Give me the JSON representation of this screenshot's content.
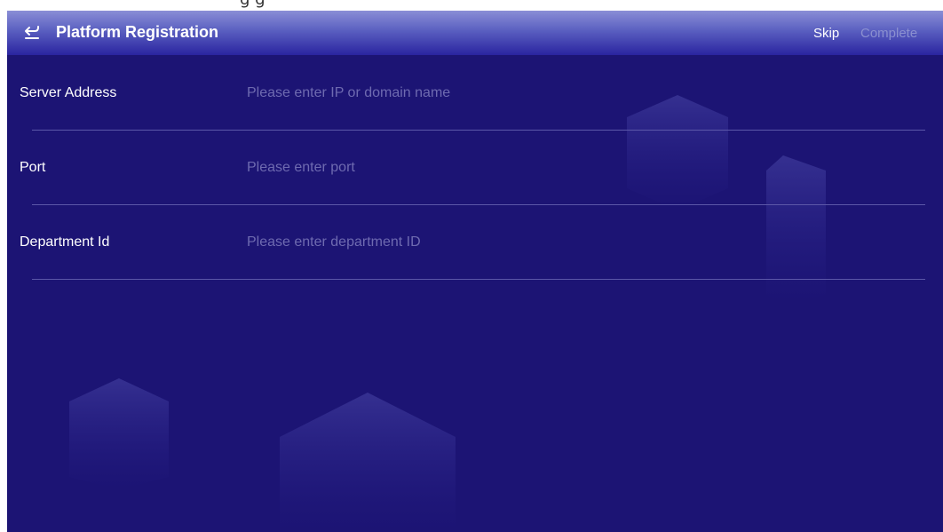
{
  "header": {
    "title": "Platform Registration",
    "skip_label": "Skip",
    "complete_label": "Complete"
  },
  "form": {
    "fields": [
      {
        "label": "Server Address",
        "placeholder": "Please enter IP or domain name",
        "value": ""
      },
      {
        "label": "Port",
        "placeholder": "Please enter port",
        "value": ""
      },
      {
        "label": "Department Id",
        "placeholder": "Please enter department ID",
        "value": ""
      }
    ]
  },
  "colors": {
    "background": "#1c1474",
    "header_top": "#8a8ed6",
    "header_bottom": "#2a24a0",
    "label_text": "#ffffff",
    "placeholder_text": "#6e6ab0",
    "disabled_action": "#8b90d0",
    "divider": "#5b57a8"
  },
  "icons": {
    "back": "return-arrow-icon"
  }
}
